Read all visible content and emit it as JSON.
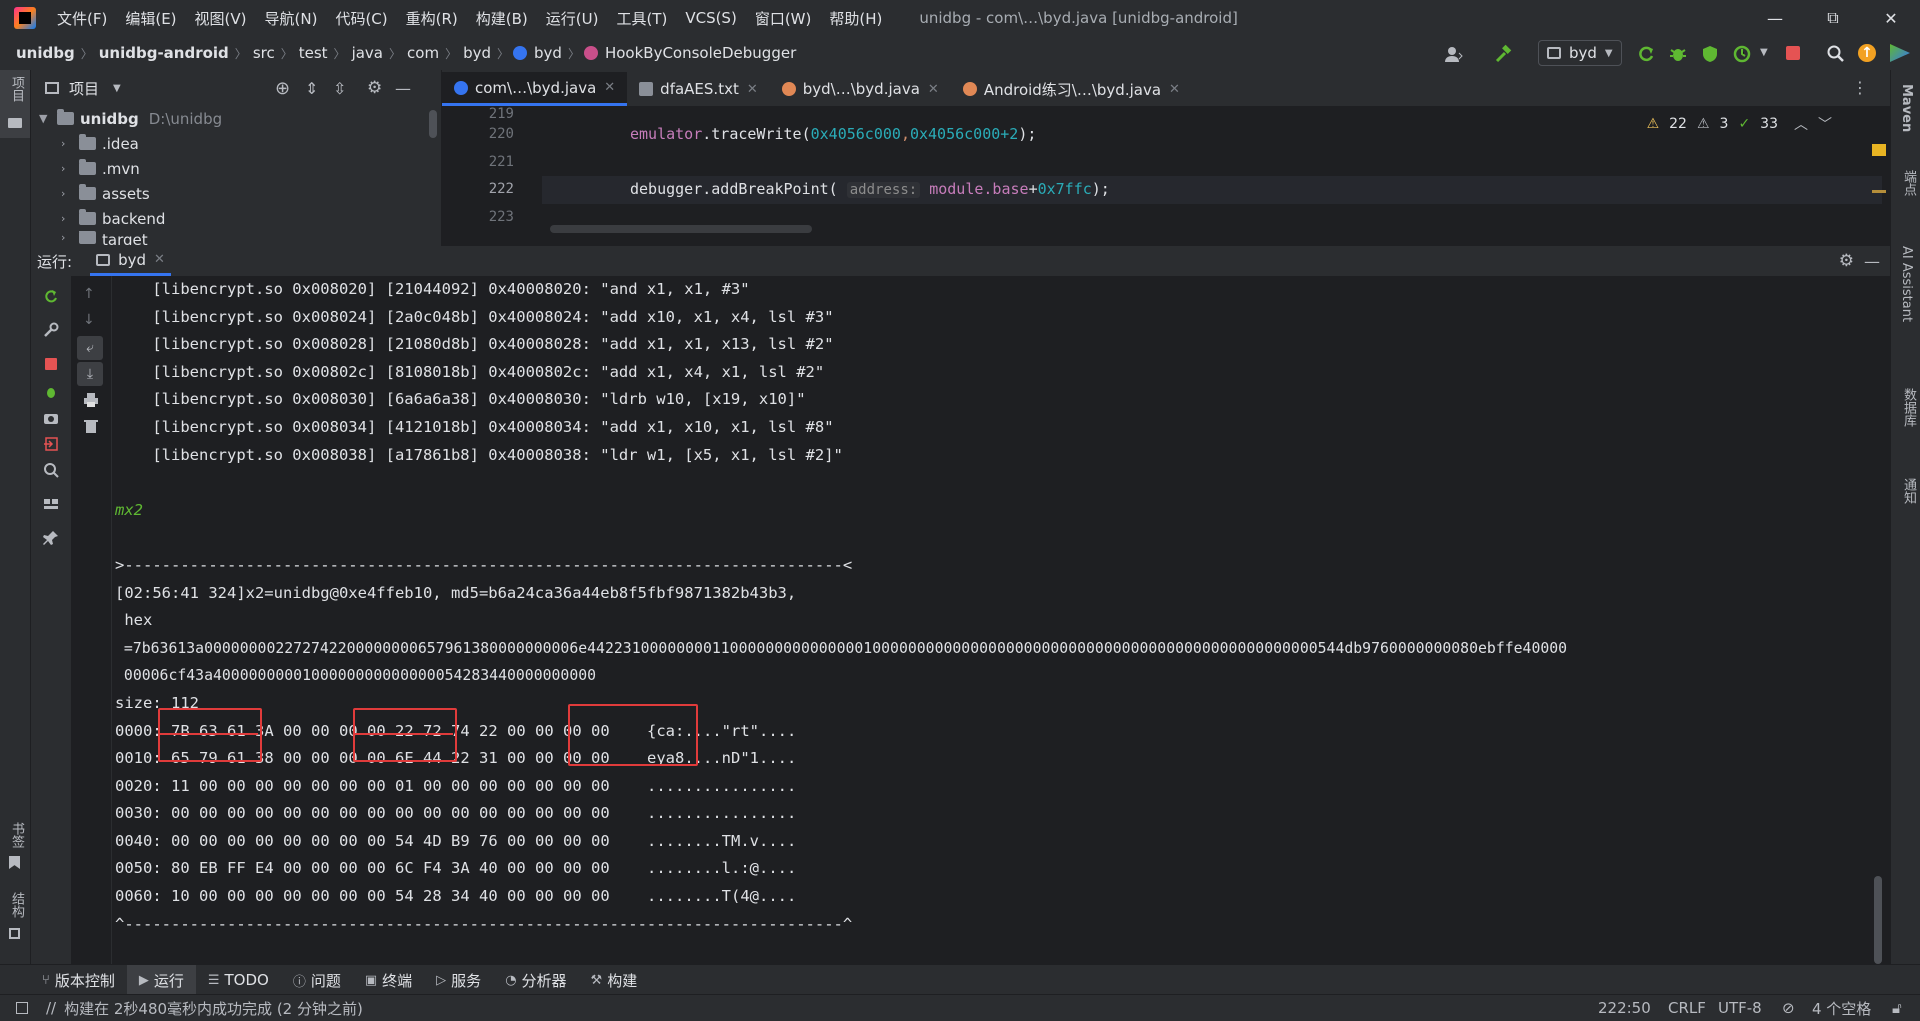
{
  "window": {
    "title": "unidbg - com\\…\\byd.java [unidbg-android]",
    "menu": [
      "文件(F)",
      "编辑(E)",
      "视图(V)",
      "导航(N)",
      "代码(C)",
      "重构(R)",
      "构建(B)",
      "运行(U)",
      "工具(T)",
      "VCS(S)",
      "窗口(W)",
      "帮助(H)"
    ]
  },
  "breadcrumb": [
    "unidbg",
    "unidbg-android",
    "src",
    "test",
    "java",
    "com",
    "byd",
    "byd",
    "HookByConsoleDebugger"
  ],
  "toolbar": {
    "run_config": "byd"
  },
  "project": {
    "title": "项目",
    "root_name": "unidbg",
    "root_path": "D:\\unidbg",
    "items": [
      ".idea",
      ".mvn",
      "assets",
      "backend",
      "target"
    ]
  },
  "editor": {
    "tabs": [
      "com\\…\\byd.java",
      "dfaAES.txt",
      "byd\\…\\byd.java",
      "Android练习\\…\\byd.java"
    ],
    "line_numbers": [
      "219",
      "220",
      "221",
      "222",
      "223"
    ],
    "code": {
      "l220_obj": "emulator",
      "l220_method": ".traceWrite(",
      "l220_arg1": "0x4056c000",
      "l220_comma": ",",
      "l220_arg2": "0x4056c000",
      "l220_plus": "+2",
      "l220_end": ");",
      "l222_obj": "debugger",
      "l222_method": ".addBreakPoint(",
      "l222_hint": "address:",
      "l222_mod": "module",
      "l222_base": ".base",
      "l222_plus": "+",
      "l222_hex": "0x7ffc",
      "l222_end": ");"
    },
    "inspections": {
      "warnings": "22",
      "weak_warnings": "3",
      "ok": "33"
    }
  },
  "run": {
    "label": "运行:",
    "tab": "byd",
    "console": {
      "trace": [
        "    [libencrypt.so 0x008020] [21044092] 0x40008020: \"and x1, x1, #3\"",
        "    [libencrypt.so 0x008024] [2a0c048b] 0x40008024: \"add x10, x1, x4, lsl #3\"",
        "    [libencrypt.so 0x008028] [21080d8b] 0x40008028: \"add x1, x1, x13, lsl #2\"",
        "    [libencrypt.so 0x00802c] [8108018b] 0x4000802c: \"add x1, x4, x1, lsl #2\"",
        "    [libencrypt.so 0x008030] [6a6a6a38] 0x40008030: \"ldrb w10, [x19, x10]\"",
        "    [libencrypt.so 0x008034] [4121018b] 0x40008034: \"add x1, x10, x1, lsl #8\"",
        "    [libencrypt.so 0x008038] [a17861b8] 0x40008038: \"ldr w1, [x5, x1, lsl #2]\""
      ],
      "mx2": "mx2",
      "sep_top": ">-----------------------------------------------------------------------------<",
      "info": "[02:56:41 324]x2=unidbg@0xe4ffeb10, md5=b6a24ca36a44eb8f5fbf9871382b43b3,",
      "hex_label": " hex",
      "hex1": " =7b63613a000000002272742200000000657961380000000006e4422310000000011000000000000000100000000000000000000000000000000000000000000000000544db9760000000080ebffe40000",
      "hex2": " 00006cf43a4000000000100000000000000054283440000000000",
      "size": "size: 112",
      "rows": [
        {
          "off": "0000:",
          "b1": "7B 63 61 3A",
          "b2": "00 00 00 00",
          "b3": "22 72 74 22",
          "b4": "00 00 00 00",
          "ascii": "{ca:....\"rt\"...."
        },
        {
          "off": "0010:",
          "b1": "65 79 61 38",
          "b2": "00 00 00 00",
          "b3": "6E 44 22 31",
          "b4": "00 00 00 00",
          "ascii": "eya8....nD\"1...."
        },
        {
          "off": "0020:",
          "b1": "11 00 00 00",
          "b2": "00 00 00 00",
          "b3": "01 00 00 00",
          "b4": "00 00 00 00",
          "ascii": "................"
        },
        {
          "off": "0030:",
          "b1": "00 00 00 00",
          "b2": "00 00 00 00",
          "b3": "00 00 00 00",
          "b4": "00 00 00 00",
          "ascii": "................"
        },
        {
          "off": "0040:",
          "b1": "00 00 00 00",
          "b2": "00 00 00 00",
          "b3": "54 4D B9 76",
          "b4": "00 00 00 00",
          "ascii": "........TM.v...."
        },
        {
          "off": "0050:",
          "b1": "80 EB FF E4",
          "b2": "00 00 00 00",
          "b3": "6C F4 3A 40",
          "b4": "00 00 00 00",
          "ascii": "........l.:@...."
        },
        {
          "off": "0060:",
          "b1": "10 00 00 00",
          "b2": "00 00 00 00",
          "b3": "54 28 34 40",
          "b4": "00 00 00 00",
          "ascii": "........T(4@...."
        }
      ],
      "sep_bottom": "^-----------------------------------------------------------------------------^"
    }
  },
  "bottom_tools": [
    "版本控制",
    "运行",
    "TODO",
    "问题",
    "终端",
    "服务",
    "分析器",
    "构建"
  ],
  "status": {
    "message": "构建在 2秒480毫秒内成功完成 (2 分钟之前)",
    "position": "222:50",
    "line_sep": "CRLF",
    "encoding": "UTF-8",
    "indent": "4 个空格"
  },
  "left_strip": {
    "top": "项目",
    "bookmarks": "书签",
    "structure": "结构"
  },
  "right_strip": {
    "maven": "Maven",
    "endpoints": "端点",
    "ai": "AI Assistant",
    "db": "数据库",
    "notify": "通知"
  },
  "colors": {
    "accent": "#3574f0",
    "highlight": "#e03b3b",
    "keyword": "#cf8e6d",
    "number": "#2aacb8",
    "field": "#c77dbb",
    "mx2": "#5fb832"
  }
}
